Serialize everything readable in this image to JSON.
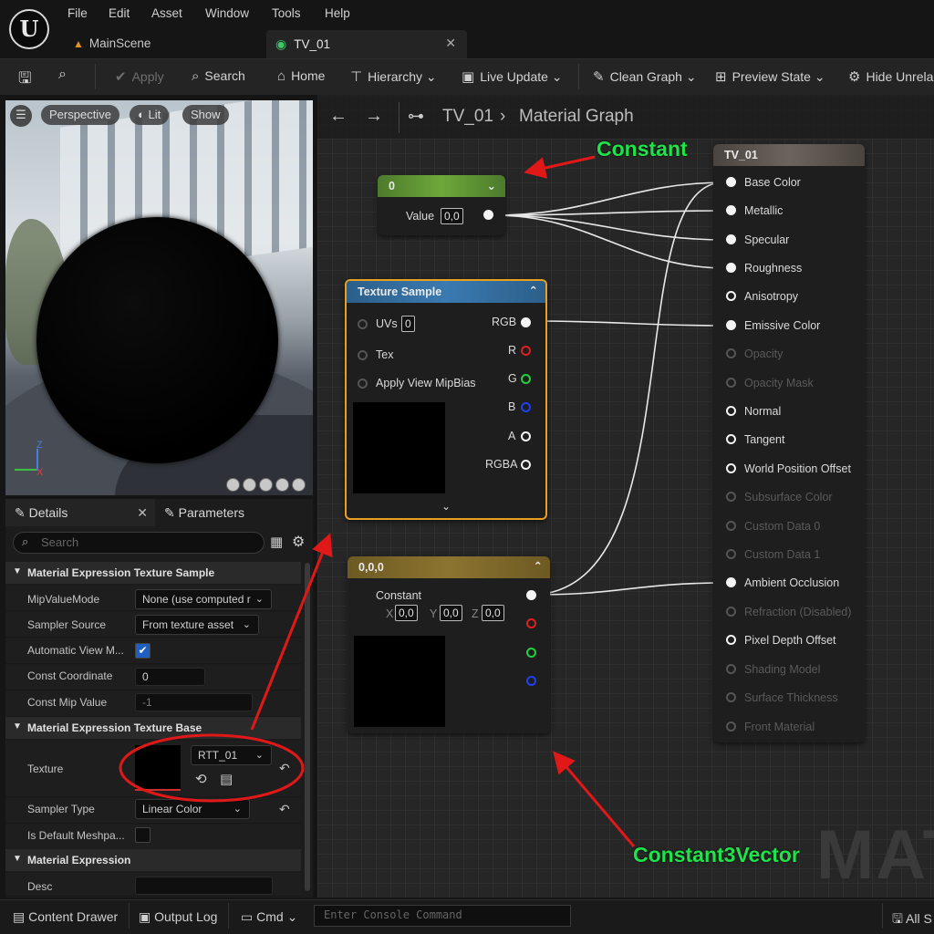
{
  "menu": {
    "items": [
      "File",
      "Edit",
      "Asset",
      "Window",
      "Tools",
      "Help"
    ]
  },
  "tabs": [
    {
      "label": "MainScene"
    },
    {
      "label": "TV_01"
    }
  ],
  "toolbar": {
    "apply": "Apply",
    "search": "Search",
    "home": "Home",
    "hierarchy": "Hierarchy",
    "live_update": "Live Update",
    "clean_graph": "Clean Graph",
    "preview_state": "Preview State",
    "hide_unrelated": "Hide Unrela"
  },
  "viewport": {
    "perspective": "Perspective",
    "lit": "Lit",
    "show": "Show"
  },
  "details": {
    "tab_details": "Details",
    "tab_params": "Parameters",
    "search_placeholder": "Search",
    "section1": "Material Expression Texture Sample",
    "mip_value_mode_label": "MipValueMode",
    "mip_value_mode": "None (use computed r",
    "sampler_source_label": "Sampler Source",
    "sampler_source": "From texture asset",
    "auto_view_mip_label": "Automatic View M...",
    "const_coord_label": "Const Coordinate",
    "const_coord": "0",
    "const_mip_label": "Const Mip Value",
    "const_mip": "-1",
    "section2": "Material Expression Texture Base",
    "texture_label": "Texture",
    "texture_value": "RTT_01",
    "sampler_type_label": "Sampler Type",
    "sampler_type": "Linear Color",
    "default_mesh_label": "Is Default Meshpa...",
    "section3": "Material Expression",
    "desc_label": "Desc"
  },
  "graph": {
    "crumb_asset": "TV_01",
    "crumb_view": "Material Graph",
    "watermark": "MATE",
    "constant_node": {
      "title": "0",
      "value_label": "Value",
      "value": "0,0"
    },
    "texture_node": {
      "title": "Texture Sample",
      "uvs": "UVs",
      "uvs_value": "0",
      "tex": "Tex",
      "apply_mip": "Apply View MipBias",
      "rgb": "RGB",
      "r": "R",
      "g": "G",
      "b": "B",
      "a": "A",
      "rgba": "RGBA"
    },
    "vector_node": {
      "title": "0,0,0",
      "label": "Constant",
      "x_label": "X",
      "x": "0,0",
      "y_label": "Y",
      "y": "0,0",
      "z_label": "Z",
      "z": "0,0"
    },
    "result_node": {
      "title": "TV_01",
      "pins": [
        "Base Color",
        "Metallic",
        "Specular",
        "Roughness",
        "Anisotropy",
        "Emissive Color",
        "Opacity",
        "Opacity Mask",
        "Normal",
        "Tangent",
        "World Position Offset",
        "Subsurface Color",
        "Custom Data 0",
        "Custom Data 1",
        "Ambient Occlusion",
        "Refraction (Disabled)",
        "Pixel Depth Offset",
        "Shading Model",
        "Surface Thickness",
        "Front Material"
      ]
    },
    "annotations": {
      "constant": "Constant",
      "constant3vector": "Constant3Vector"
    }
  },
  "statusbar": {
    "content_drawer": "Content Drawer",
    "output_log": "Output Log",
    "cmd": "Cmd",
    "console_placeholder": "Enter Console Command",
    "all": "All S"
  }
}
